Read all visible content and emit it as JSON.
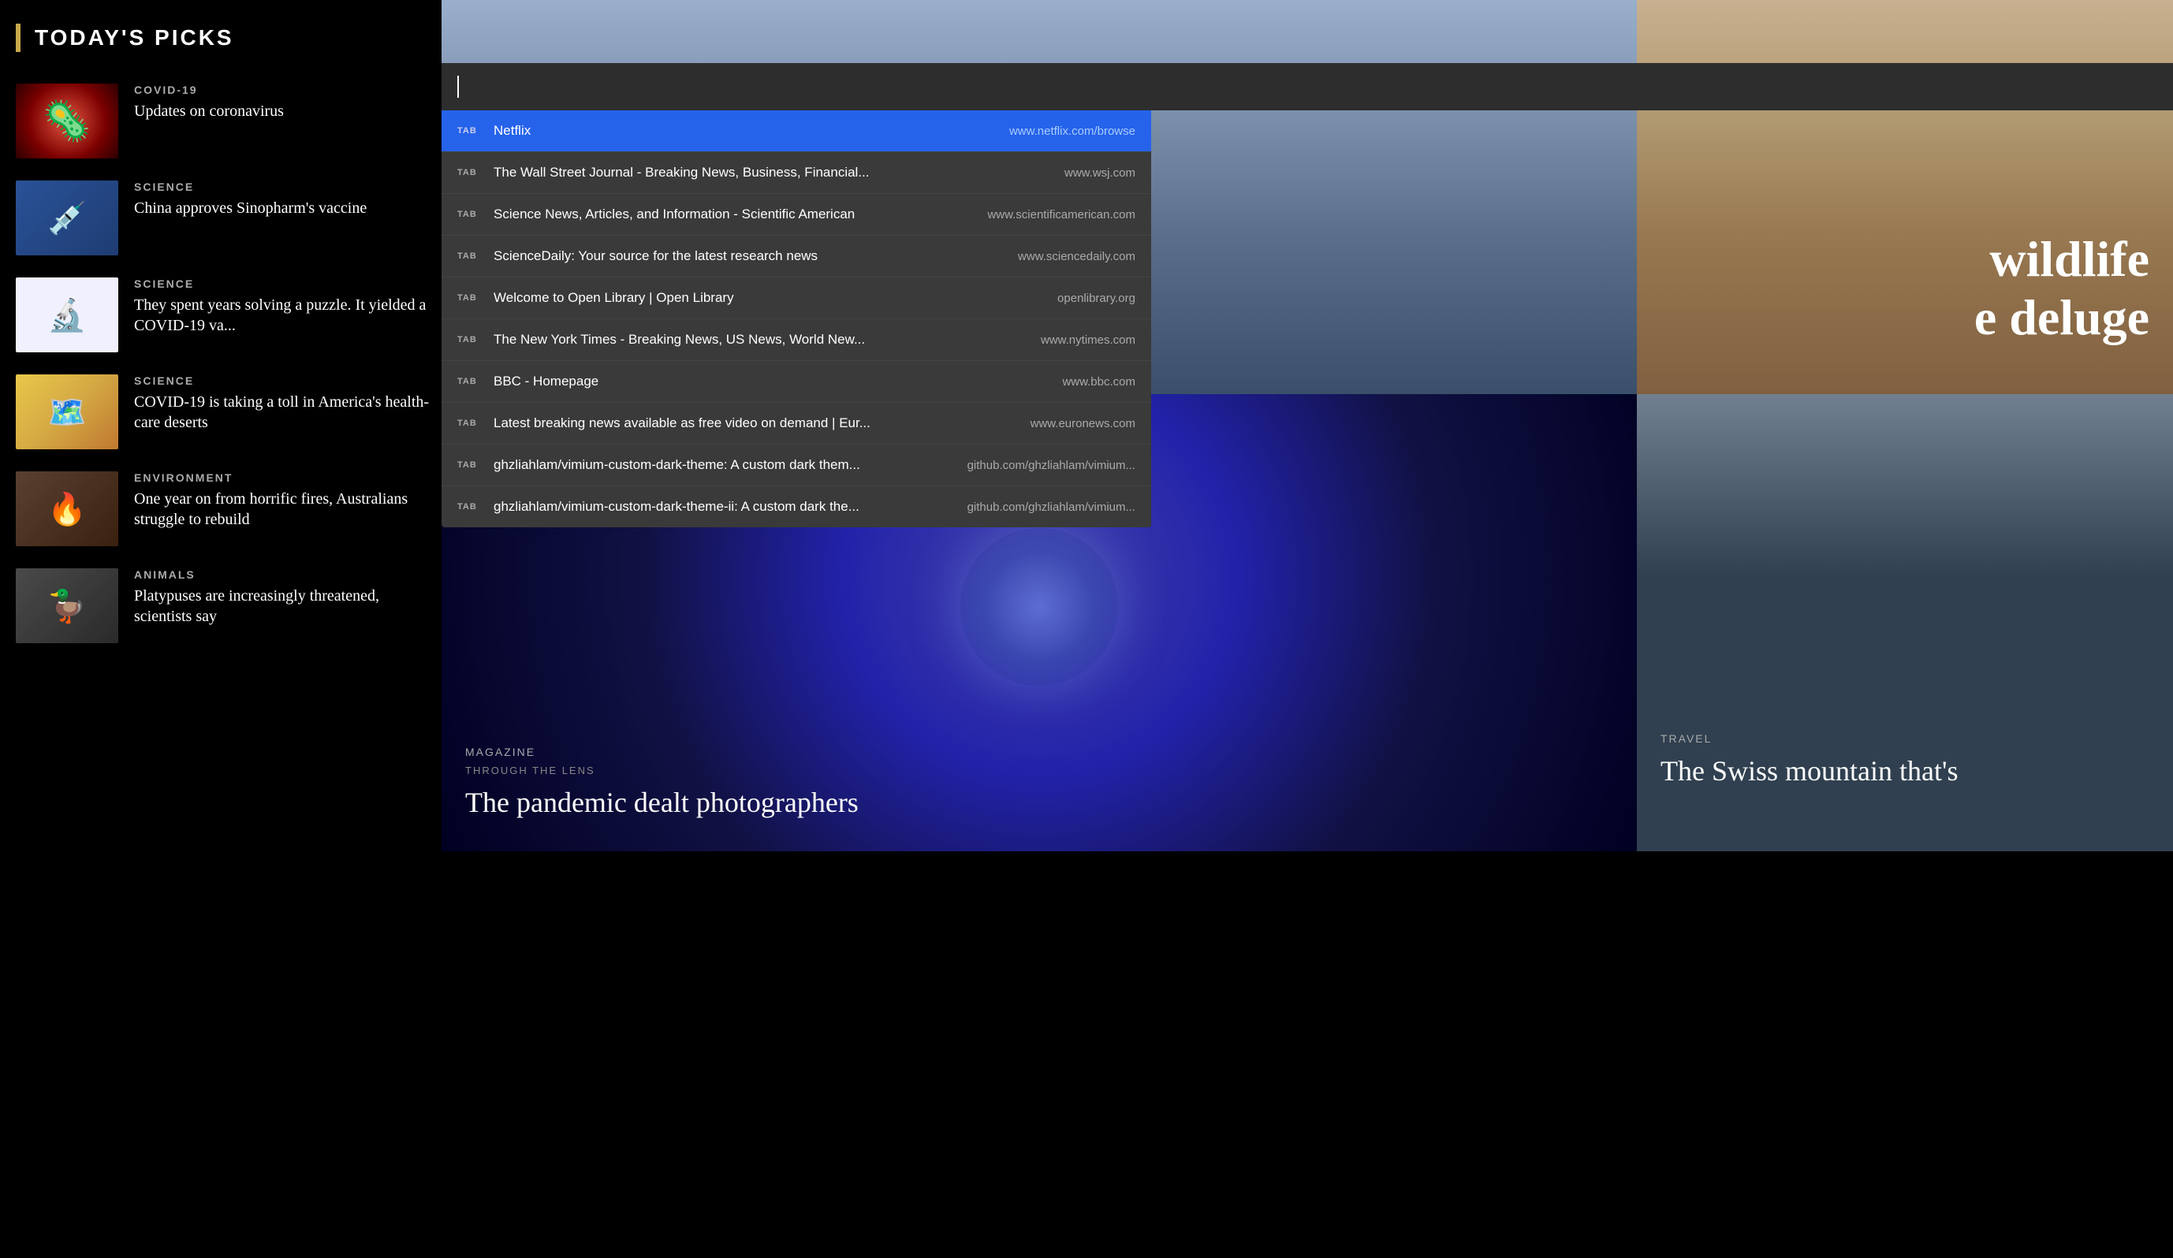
{
  "sidebar": {
    "header": {
      "title": "TODAY'S PICKS",
      "accent_color": "#c8a84b"
    },
    "items": [
      {
        "category": "COVID-19",
        "headline": "Updates on coronavirus",
        "thumb_type": "covid"
      },
      {
        "category": "SCIENCE",
        "headline": "China approves Sinopharm's vaccine",
        "thumb_type": "vaccine"
      },
      {
        "category": "SCIENCE",
        "headline": "They spent years solving a puzzle. It yielded a COVID-19 va...",
        "thumb_type": "molecule"
      },
      {
        "category": "SCIENCE",
        "headline": "COVID-19 is taking a toll in America's health-care deserts",
        "thumb_type": "map"
      },
      {
        "category": "ENVIRONMENT",
        "headline": "One year on from horrific fires, Australians struggle to rebuild",
        "thumb_type": "fire"
      },
      {
        "category": "ANIMALS",
        "headline": "Platypuses are increasingly threatened, scientists say",
        "thumb_type": "platypus"
      }
    ]
  },
  "address_bar": {
    "value": ""
  },
  "tab_dropdown": {
    "items": [
      {
        "label": "TAB",
        "title": "Netflix",
        "url": "www.netflix.com/browse",
        "active": true
      },
      {
        "label": "TAB",
        "title": "The Wall Street Journal - Breaking News, Business, Financial...",
        "url": "www.wsj.com",
        "active": false
      },
      {
        "label": "TAB",
        "title": "Science News, Articles, and Information - Scientific American",
        "url": "www.scientificamerican.com",
        "active": false
      },
      {
        "label": "TAB",
        "title": "ScienceDaily: Your source for the latest research news",
        "url": "www.sciencedaily.com",
        "active": false
      },
      {
        "label": "TAB",
        "title": "Welcome to Open Library | Open Library",
        "url": "openlibrary.org",
        "active": false
      },
      {
        "label": "TAB",
        "title": "The New York Times - Breaking News, US News, World New...",
        "url": "www.nytimes.com",
        "active": false
      },
      {
        "label": "TAB",
        "title": "BBC - Homepage",
        "url": "www.bbc.com",
        "active": false
      },
      {
        "label": "TAB",
        "title": "Latest breaking news available as free video on demand | Eur...",
        "url": "www.euronews.com",
        "active": false
      },
      {
        "label": "TAB",
        "title": "ghzliahlam/vimium-custom-dark-theme: A custom dark them...",
        "url": "github.com/ghzliahlam/vimium...",
        "active": false
      },
      {
        "label": "TAB",
        "title": "ghzliahlam/vimium-custom-dark-theme-ii: A custom dark the...",
        "url": "github.com/ghzliahlam/vimium...",
        "active": false
      }
    ]
  },
  "main_content": {
    "banner": {
      "wildlife_line1": "wildlife",
      "wildlife_line2": "deluge"
    },
    "featured_left": {
      "category": "MAGAZINE",
      "subcategory": "THROUGH THE LENS",
      "headline": "The pandemic dealt photographers"
    },
    "featured_right": {
      "category": "TRAVEL",
      "headline": "The Swiss mountain that's"
    }
  }
}
